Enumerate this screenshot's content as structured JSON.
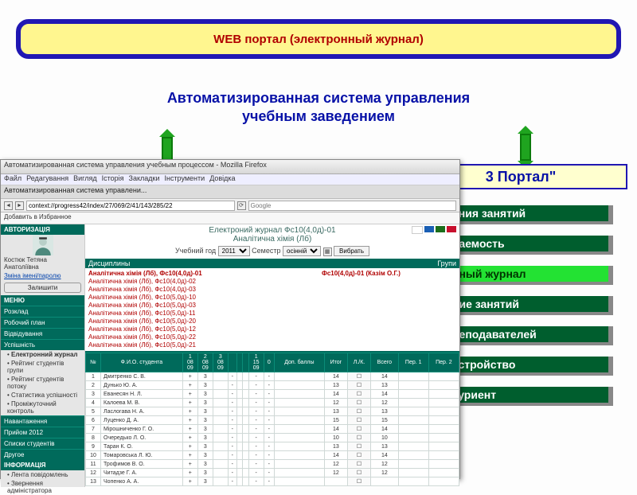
{
  "banner": {
    "label": "WEB портал (электронный журнал)"
  },
  "subtitle": {
    "line1": "Автоматизированная система управления",
    "line2": "учебным заведением"
  },
  "right": {
    "portal_label": "3 Портал\"",
    "items": [
      {
        "label": "ания занятий",
        "active": false
      },
      {
        "label": "ваемость",
        "active": false
      },
      {
        "label": "нный журнал",
        "active": true
      },
      {
        "label": "ние занятий",
        "active": false
      },
      {
        "label": "реподавателей",
        "active": false
      },
      {
        "label": "устройство",
        "active": false
      },
      {
        "label": "туриент",
        "active": false
      }
    ]
  },
  "browser": {
    "title": "Автоматизированная система управления учебным процессом - Mozilla Firefox",
    "menu": [
      "Файл",
      "Редагування",
      "Вигляд",
      "Історія",
      "Закладки",
      "Інструменти",
      "Довідка"
    ],
    "tab": "Автоматизированная система управлени...",
    "url": "context://progress42/index/27/069/2/41/143/285/22",
    "search_placeholder": "Google",
    "fav": "Добавить в Избранное"
  },
  "side": {
    "auth": "АВТОРИЗАЦІЯ",
    "user": "Костюк Тетяна Анатоліївна",
    "link": "Зміна імені/паролю",
    "btn": "Залишити",
    "menu": "МЕНЮ",
    "items": [
      "Розклад",
      "Робочий план",
      "Відвідування",
      "Успішність"
    ],
    "bullets": [
      "Електронний журнал",
      "Рейтинг студентів групи",
      "Рейтинг студентів потоку",
      "Статистика успішності",
      "Проміжуточний контроль"
    ],
    "items2": [
      "Навантаження",
      "Прийом 2012",
      "Списки студентів",
      "Другое"
    ],
    "info": "ІНФОРМАЦІЯ",
    "info_items": [
      "Лента повідомлень",
      "Звернення адміністратора"
    ]
  },
  "main": {
    "title1": "Електроний журнал Фс10(4,0д)-01",
    "title2": "Аналітична хімія (Лб)",
    "year_label": "Учебний год",
    "year": "2011",
    "sem_label": "Семестр",
    "sem": "осінній",
    "btn": "Вибрать",
    "disc_hdr": "Дисциплины",
    "grp_hdr": "Групи",
    "disc_current": "Аналітична хімія (Лб),  Фс10(4,0д)-01",
    "disciplines": [
      "Аналітична хімія (Лб),  Фс10(4,0д)-02",
      "Аналітична хімія (Лб),  Фс10(4,0д)-03",
      "Аналітична хімія (Лб),  Фс10(5,0д)-10",
      "Аналітична хімія (Лб),  Фс10(5,0д)-03",
      "Аналітична хімія (Лб),  Фс10(5,0д)-11",
      "Аналітична хімія (Лб),  Фс10(5,0д)-20",
      "Аналітична хімія (Лб),  Фс10(5,0д)-12",
      "Аналітична хімія (Лб),  Фс10(5,0д)-22",
      "Аналітична хімія (Лб),  Фс10(5,0д)-21"
    ],
    "group": "Фс10(4,0д)-01 (Казім О.Г.)",
    "cols": {
      "num": "№",
      "name": "Ф.И.О. студента",
      "d1": "1\n08\n09",
      "d2": "2\n08\n09",
      "d3": "3\n08\n09",
      "d4": "",
      "d5": "",
      "d6": "",
      "d7": "1\n15\n09",
      "d8": "0\n",
      "dop": "Доп. баллы",
      "itog": "Итог",
      "lk": "Л./К.",
      "vs": "Всего",
      "p1": "Пер. 1",
      "p2": "Пер. 2"
    },
    "students": [
      {
        "n": 1,
        "name": "Дмитренко С. В.",
        "itog": 14,
        "vs": 14
      },
      {
        "n": 2,
        "name": "Дунько Ю. А.",
        "itog": 13,
        "vs": 13
      },
      {
        "n": 3,
        "name": "Еванесян Н. Л.",
        "itog": 14,
        "vs": 14
      },
      {
        "n": 4,
        "name": "Калоева М. В.",
        "itog": 12,
        "vs": 12
      },
      {
        "n": 5,
        "name": "Ласлогава Н. А.",
        "itog": 13,
        "vs": 13
      },
      {
        "n": 6,
        "name": "Луценко Д. А.",
        "itog": 15,
        "vs": 15
      },
      {
        "n": 7,
        "name": "Мірошниченко Г. О.",
        "itog": 14,
        "vs": 14
      },
      {
        "n": 8,
        "name": "Очередько Л. О.",
        "itog": 10,
        "vs": 10
      },
      {
        "n": 9,
        "name": "Таран К. О.",
        "itog": 13,
        "vs": 13
      },
      {
        "n": 10,
        "name": "Томаровська Л. Ю.",
        "itog": 14,
        "vs": 14
      },
      {
        "n": 11,
        "name": "Трофимов В. О.",
        "itog": 12,
        "vs": 12
      },
      {
        "n": 12,
        "name": "Читадзе Г. А.",
        "itog": 12,
        "vs": 12
      },
      {
        "n": 13,
        "name": "Чопенко А. А.",
        "itog": "",
        "vs": ""
      }
    ]
  }
}
